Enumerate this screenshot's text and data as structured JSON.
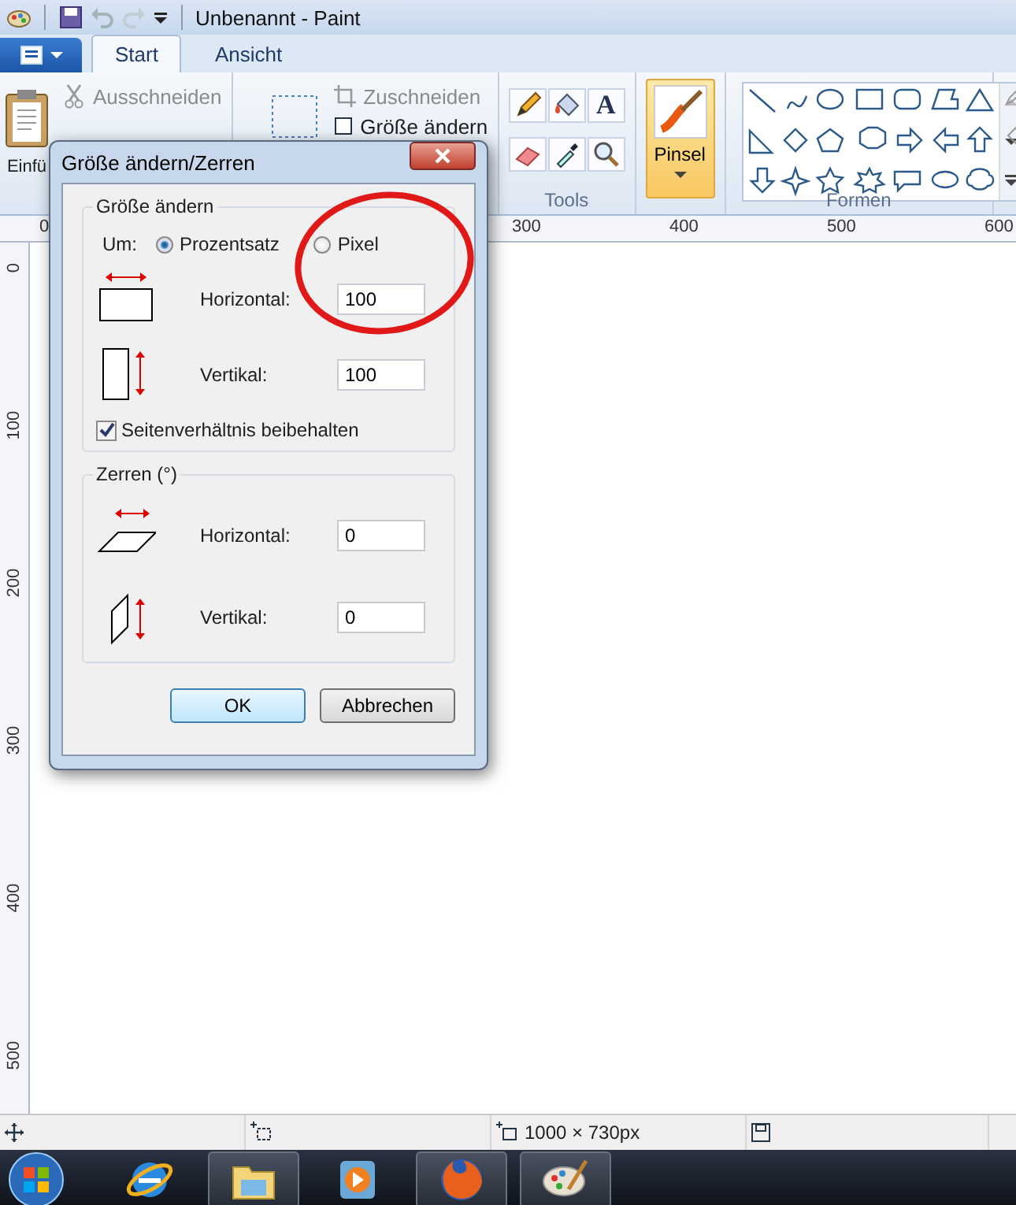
{
  "window": {
    "title": "Unbenannt - Paint"
  },
  "tabs": [
    {
      "label": "Start",
      "selected": true
    },
    {
      "label": "Ansicht",
      "selected": false
    }
  ],
  "ribbon": {
    "paste_label": "Einfü",
    "cut": "Ausschneiden",
    "crop": "Zuschneiden",
    "resize": "Größe ändern",
    "text_tool": "A",
    "tools_label": "Tools",
    "brush": {
      "label": "Pinsel",
      "selected": true
    },
    "shapes_label": "Formen"
  },
  "rulers": {
    "horizontal": [
      "0",
      "300",
      "400",
      "500",
      "600"
    ],
    "vertical": [
      "0",
      "100",
      "200",
      "300",
      "400",
      "500"
    ]
  },
  "dialog": {
    "title": "Größe ändern/Zerren",
    "resize": {
      "title": "Größe ändern",
      "by_label": "Um:",
      "options": [
        {
          "label": "Prozentsatz",
          "selected": true
        },
        {
          "label": "Pixel",
          "selected": false
        }
      ],
      "fields": [
        {
          "kind": "horizontal",
          "label": "Horizontal:",
          "value": "100"
        },
        {
          "kind": "vertical",
          "label": "Vertikal:",
          "value": "100"
        }
      ],
      "keep_ratio": {
        "label": "Seitenverhältnis beibehalten",
        "checked": true
      }
    },
    "skew": {
      "title": "Zerren (°)",
      "fields": [
        {
          "kind": "horizontal",
          "label": "Horizontal:",
          "value": "0"
        },
        {
          "kind": "vertical",
          "label": "Vertikal:",
          "value": "0"
        }
      ]
    },
    "buttons": [
      {
        "label": "OK",
        "default": true
      },
      {
        "label": "Abbrechen",
        "default": false
      }
    ]
  },
  "status_bar": {
    "canvas_size": "1000 × 730px"
  },
  "taskbar": {
    "apps": [
      {
        "kind": "browser",
        "running": false
      },
      {
        "kind": "folder",
        "running": true
      },
      {
        "kind": "media",
        "running": false
      },
      {
        "kind": "firefox",
        "running": true
      },
      {
        "kind": "paint",
        "running": true
      }
    ]
  }
}
